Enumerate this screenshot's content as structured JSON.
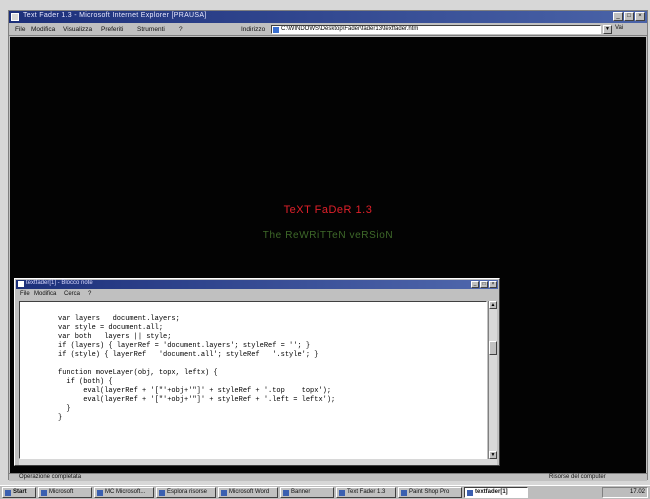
{
  "browser": {
    "title": "Text Fader 1.3 - Microsoft Internet Explorer [PRAUSA]",
    "menu": [
      "File",
      "Modifica",
      "Visualizza",
      "Preferiti",
      "Strumenti",
      "?"
    ],
    "address_label": "Indirizzo",
    "address_value": "C:\\WINDOWS\\Desktop\\Fader\\fader13\\textfader.htm",
    "go_label": "Vai",
    "status_text": "Operazione completata",
    "status_zone": "Risorse del computer"
  },
  "page": {
    "title": "TeXT FaDeR 1.3",
    "subtitle": "The ReWRiTTeN veRSioN",
    "title_color": "#e0202a",
    "subtitle_color": "#3f6a2a",
    "background": "#030303"
  },
  "source_window": {
    "title": "textfader[1] - Blocco note",
    "menu": [
      "File",
      "Modifica",
      "Cerca",
      "?"
    ],
    "code": [
      "var layers   document.layers;",
      "var style = document.all;",
      "var both   layers || style;",
      "if (layers) { layerRef = 'document.layers'; styleRef = ''; }",
      "if (style) { layerRef   'document.all'; styleRef   '.style'; }",
      "",
      "function moveLayer(obj, topx, leftx) {",
      "  if (both) {",
      "      eval(layerRef + '[\"'+obj+'\"]' + styleRef + '.top    topx');",
      "      eval(layerRef + '[\"'+obj+'\"]' + styleRef + '.left = leftx');",
      "  }",
      "}"
    ]
  },
  "taskbar": {
    "start_label": "Start",
    "items": [
      "Microsoft",
      "MC Microsoft...",
      "Esplora risorse",
      "Microsoft Word",
      "Banner",
      "Text Fader 1.3",
      "Paint Shop Pro",
      "textfader[1]"
    ],
    "clock": "17.02"
  }
}
